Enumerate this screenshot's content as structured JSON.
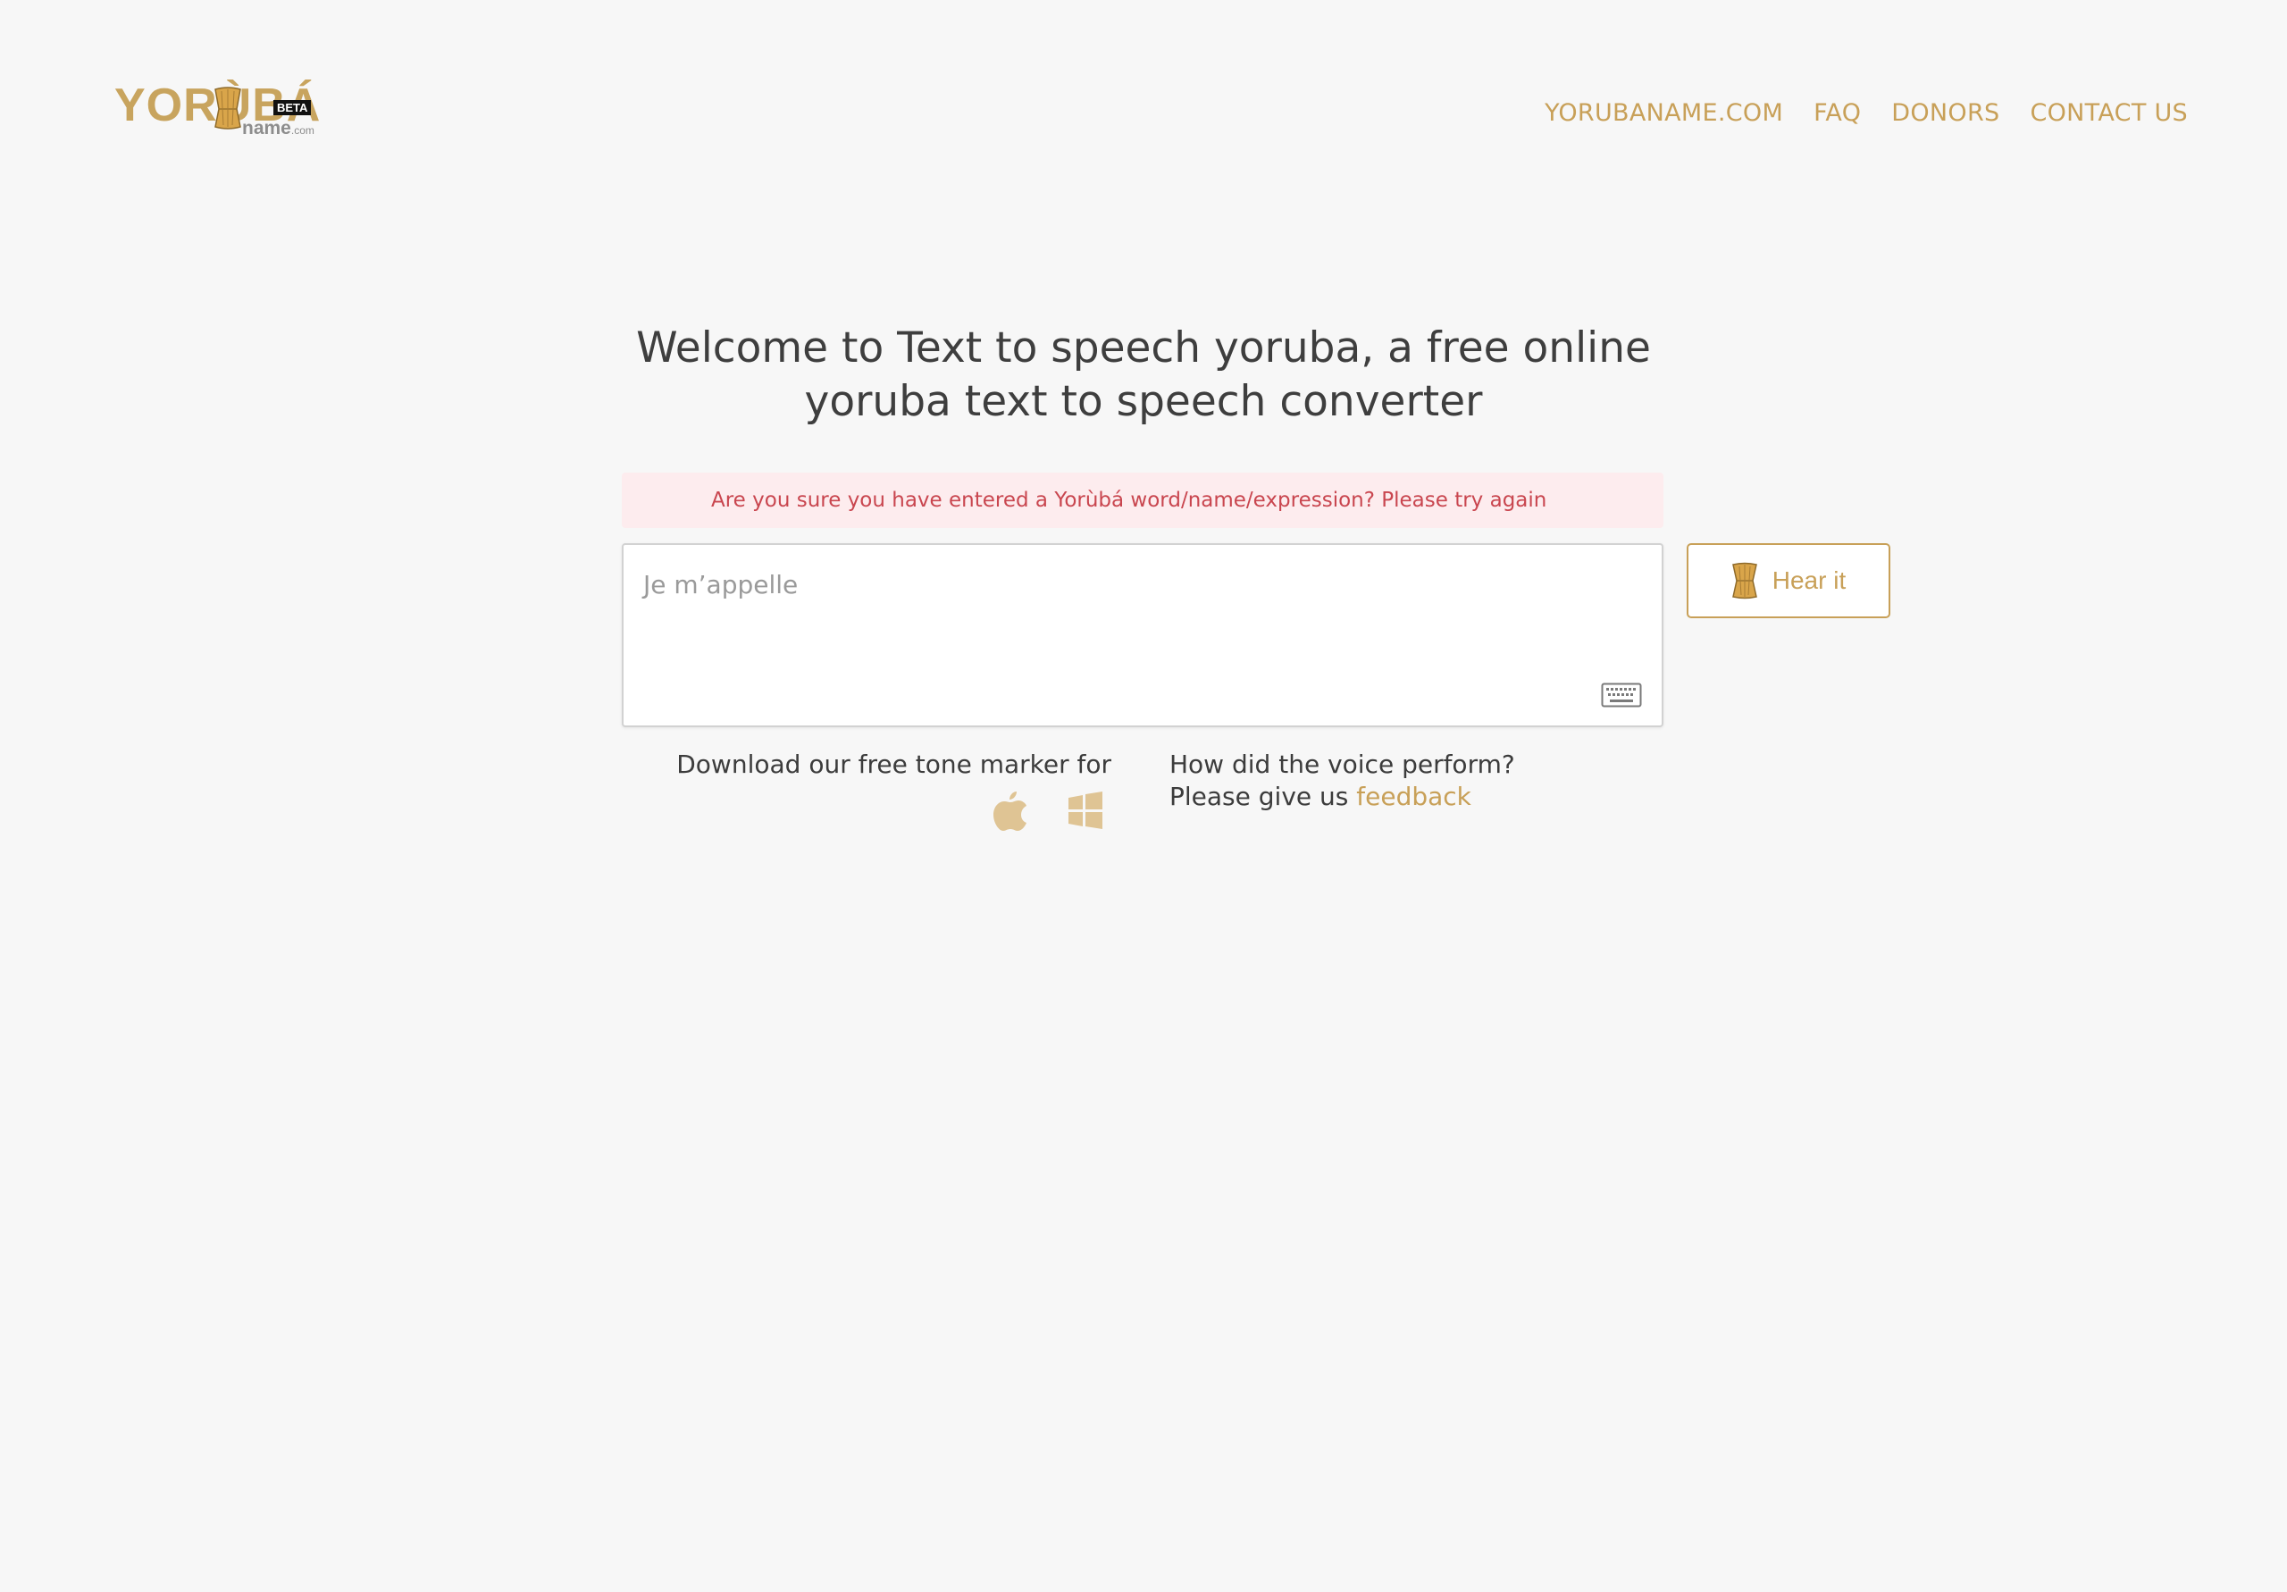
{
  "logo": {
    "word": "YORÙBÁ",
    "badge": "BETA",
    "subtext": "name",
    "subtext_suffix": ".com"
  },
  "nav": {
    "items": [
      {
        "label": "YORUBANAME.COM"
      },
      {
        "label": "FAQ"
      },
      {
        "label": "DONORS"
      },
      {
        "label": "CONTACT US"
      }
    ]
  },
  "main": {
    "title": "Welcome to Text to speech yoruba, a free online yoruba text to speech converter",
    "alert": "Are you sure you have entered a Yorùbá word/name/expression? Please try again",
    "input": {
      "placeholder": "Je m’appelle",
      "value": ""
    },
    "hear_button": "Hear it",
    "download_text": "Download our free tone marker for",
    "download_icons": [
      "apple-icon",
      "windows-icon"
    ],
    "feedback_prefix": "How did the voice perform? Please give us",
    "feedback_link": "feedback"
  },
  "colors": {
    "accent": "#c8a058",
    "background": "#f7f7f7",
    "alert_bg": "#fdecee",
    "alert_text": "#c9464f",
    "text": "#3c3c3c"
  }
}
